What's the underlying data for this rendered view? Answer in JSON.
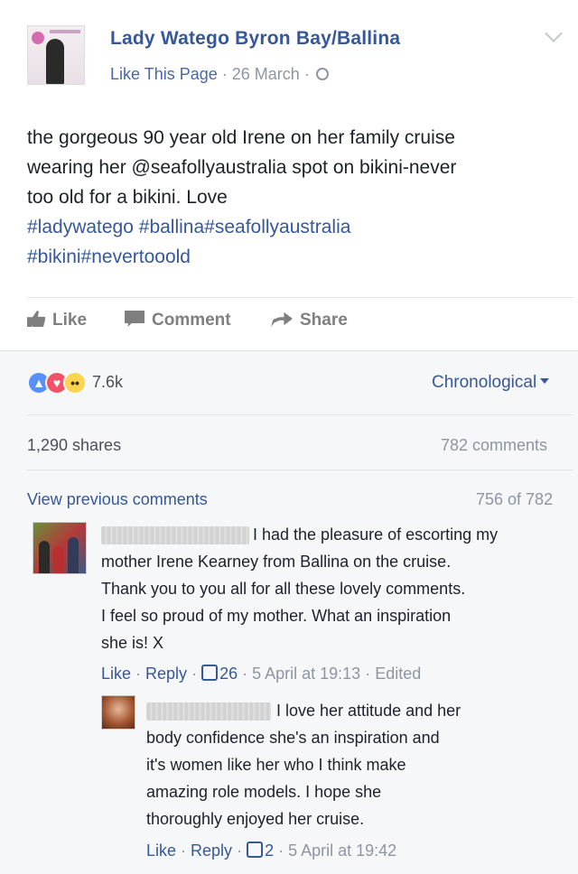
{
  "post": {
    "page_name": "Lady Watego Byron Bay/Ballina",
    "like_page": "Like This Page",
    "date": "26 March",
    "separator": " · ",
    "text_lines": [
      "the gorgeous 90 year old Irene on her family cruise",
      "wearing her @seafollyaustralia spot on bikini-never",
      "too old for a bikini. Love"
    ],
    "hashtags_line1": [
      "#ladywatego",
      "#ballina",
      "#seafollyaustralia"
    ],
    "hashtags_line2": [
      "#bikini",
      "#nevertooold"
    ],
    "actions": {
      "like": "Like",
      "comment": "Comment",
      "share": "Share"
    }
  },
  "feedback": {
    "reaction_count": "7.6k",
    "reaction_icons": [
      "like-reaction-icon",
      "love-reaction-icon",
      "wow-reaction-icon"
    ],
    "sort": "Chronological",
    "shares": "1,290 shares",
    "comments": "782 comments",
    "view_previous": "View previous comments",
    "previous_count": "756 of 782"
  },
  "comments": [
    {
      "lines": [
        "I had the pleasure of escorting my",
        "mother Irene Kearney from Ballina on the cruise.",
        "Thank you to you all for all these lovely comments.",
        "I feel so proud of my mother. What an inspiration",
        "she is! X"
      ],
      "like": "Like",
      "reply": "Reply",
      "likes": "26",
      "time": "5 April at 19:13",
      "edited": "Edited"
    },
    {
      "lines": [
        "I love her attitude and her",
        "body confidence she's an inspiration and",
        "it's women like her who I think make",
        "amazing role models. I hope she",
        "thoroughly enjoyed her cruise."
      ],
      "like": "Like",
      "reply": "Reply",
      "likes": "2",
      "time": "5 April at 19:42"
    }
  ],
  "colors": {
    "link": "#365899",
    "meta": "#8e95a1",
    "like_reaction": "#5890ff",
    "love_reaction": "#f25268",
    "wow_reaction": "#fcd44f"
  }
}
